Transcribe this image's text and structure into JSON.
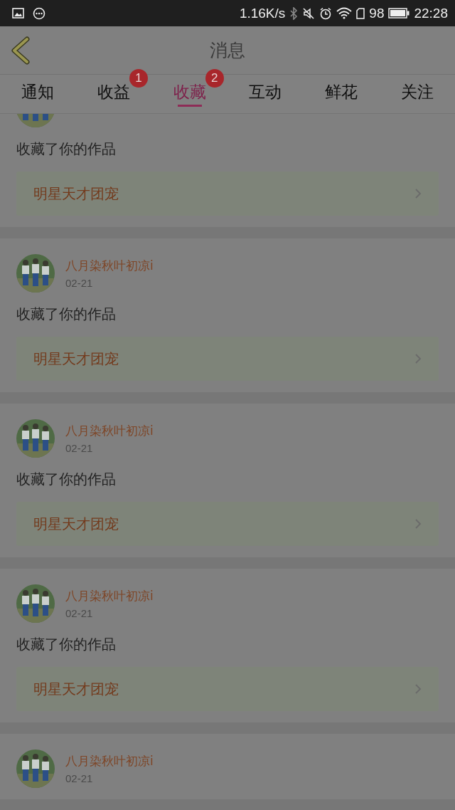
{
  "status_bar": {
    "speed": "1.16K/s",
    "battery": "98",
    "time": "22:28"
  },
  "header": {
    "title": "消息"
  },
  "tabs": [
    {
      "label": "通知",
      "selected": false
    },
    {
      "label": "收益",
      "selected": false,
      "badge": "1"
    },
    {
      "label": "收藏",
      "selected": true,
      "badge": "2"
    },
    {
      "label": "互动",
      "selected": false
    },
    {
      "label": "鲜花",
      "selected": false
    },
    {
      "label": "关注",
      "selected": false
    }
  ],
  "messages": [
    {
      "text": "收藏了你的作品",
      "work": "明星天才团宠"
    },
    {
      "name": "八月染秋叶初凉i",
      "date": "02-21",
      "text": "收藏了你的作品",
      "work": "明星天才团宠"
    },
    {
      "name": "八月染秋叶初凉i",
      "date": "02-21",
      "text": "收藏了你的作品",
      "work": "明星天才团宠"
    },
    {
      "name": "八月染秋叶初凉i",
      "date": "02-21",
      "text": "收藏了你的作品",
      "work": "明星天才团宠"
    },
    {
      "name": "八月染秋叶初凉i",
      "date": "02-21"
    }
  ]
}
